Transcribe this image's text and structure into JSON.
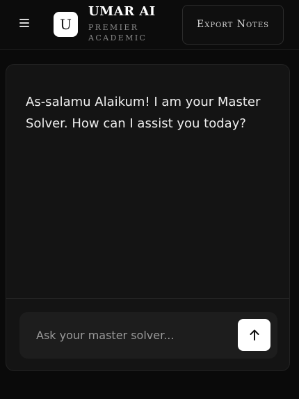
{
  "header": {
    "logo_letter": "U",
    "title": "UMAR AI",
    "subtitle": "Premier Academic",
    "export_label": "Export Notes",
    "icons": {
      "menu": "hamburger-menu-icon",
      "send": "arrow-up-icon"
    }
  },
  "chat": {
    "messages": [
      {
        "role": "assistant",
        "text": "As-salamu Alaikum! I am your Master Solver. How can I assist you today?"
      }
    ],
    "input": {
      "value": "",
      "placeholder": "Ask your master solver..."
    }
  },
  "colors": {
    "background": "#0a0a0a",
    "card": "#141414",
    "input": "#1d1d1d",
    "accent": "#ffffff"
  }
}
